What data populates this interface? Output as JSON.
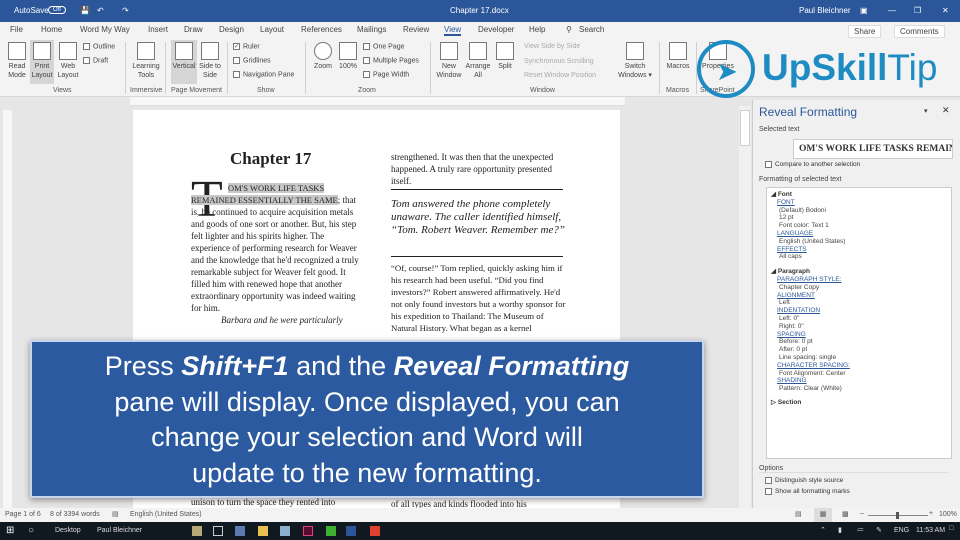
{
  "titlebar": {
    "autosave": "AutoSave",
    "autosave_state": "Off",
    "doc_title": "Chapter 17.docx",
    "user": "Paul Bleichner"
  },
  "tabs": [
    "File",
    "Home",
    "Word My Way",
    "Insert",
    "Draw",
    "Design",
    "Layout",
    "References",
    "Mailings",
    "Review",
    "View",
    "Developer",
    "Help"
  ],
  "search": "Search",
  "share": "Share",
  "comments": "Comments",
  "ribbon": {
    "views": {
      "read_mode": "Read Mode",
      "print_layout": "Print Layout",
      "web_layout": "Web Layout",
      "outline": "Outline",
      "draft": "Draft",
      "group": "Views"
    },
    "immersive": {
      "learning_tools": "Learning Tools",
      "group": "Immersive"
    },
    "page_movement": {
      "vertical": "Vertical",
      "side_to_side": "Side to Side",
      "group": "Page Movement"
    },
    "show": {
      "ruler": "Ruler",
      "ruler_checked": true,
      "gridlines": "Gridlines",
      "navigation_pane": "Navigation Pane",
      "group": "Show"
    },
    "zoom": {
      "zoom": "Zoom",
      "hundred": "100%",
      "one_page": "One Page",
      "multiple_pages": "Multiple Pages",
      "page_width": "Page Width",
      "group": "Zoom"
    },
    "window": {
      "new_window": "New Window",
      "arrange_all": "Arrange All",
      "split": "Split",
      "view_side_by_side": "View Side by Side",
      "sync_scrolling": "Synchronous Scrolling",
      "reset_position": "Reset Window Position",
      "switch_windows": "Switch Windows",
      "group": "Window"
    },
    "macros": {
      "macros": "Macros",
      "group": "Macros"
    },
    "sharepoint": {
      "properties": "Properties",
      "group": "SharePoint"
    }
  },
  "logo": {
    "text_bold": "UpSkill",
    "text_light": "Tip",
    "color": "#1e8bc3"
  },
  "document": {
    "chapter_title": "Chapter 17",
    "drop_cap": "T",
    "selected_text": "OM'S WORK LIFE TASKS REMAINED ESSENTIALLY THE SAME",
    "left_col": "; that is, he continued to acquire acquisition metals and goods of one sort or another. But, his step felt lighter and his spirits higher. The experience of performing research for Weaver and the knowledge that he'd recognized a truly remarkable subject for Weaver felt good. It filled him with renewed hope that another extraordinary opportunity was indeed waiting for him.",
    "left_italic": "Barbara and he were particularly",
    "left_bottom": "unison to turn the space they rented into",
    "right_top": "strengthened. It was then that the unexpected happened. A truly rare opportunity presented itself.",
    "pull_quote": "Tom answered the phone completely unaware. The caller identified himself, “Tom. Robert Weaver. Remember me?”",
    "right_body": "“Of, course!” Tom replied, quickly asking him if his research had been useful. “Did you find investors?” Robert answered affirmatively. He'd not only found investors but a worthy sponsor for his expedition to Thailand: The Museum of Natural History. What began as a kernel",
    "right_bottom": "of all types and kinds flooded into his"
  },
  "overlay": {
    "l1a": "Press ",
    "l1b": "Shift+F1",
    "l1c": " and the ",
    "l1d": "Reveal Formatting",
    "l2": "pane will display. Once displayed, you can",
    "l3": "change your selection and Word will",
    "l4": "update to the new formatting."
  },
  "pane": {
    "title": "Reveal Formatting",
    "selected_label": "Selected text",
    "selected_value": "OM'S WORK LIFE TASKS REMAINED E",
    "compare": "Compare to another selection",
    "formatting_label": "Formatting of selected text",
    "font_head": "Font",
    "font_link": "FONT",
    "font_vals": [
      "(Default) Bodoni",
      "12 pt",
      "Font color: Text 1"
    ],
    "language_link": "LANGUAGE",
    "language_val": "English (United States)",
    "effects_link": "EFFECTS",
    "effects_val": "All caps",
    "para_head": "Paragraph",
    "pstyle_link": "PARAGRAPH STYLE:",
    "pstyle_val": "Chapter Copy",
    "align_link": "ALIGNMENT",
    "align_val": "Left",
    "indent_link": "INDENTATION",
    "indent_vals": [
      "Left:  0\"",
      "Right:  0\""
    ],
    "spacing_link": "SPACING",
    "spacing_vals": [
      "Before:  0 pt",
      "After:  0 pt",
      "Line spacing:  single"
    ],
    "charsp_link": "CHARACTER SPACING:",
    "charsp_val": "Font Alignment: Center",
    "shading_link": "SHADING",
    "shading_val": "Pattern: Clear (White)",
    "section_head": "Section",
    "options": "Options",
    "distinguish": "Distinguish style source",
    "show_marks": "Show all formatting marks"
  },
  "status": {
    "page": "Page 1 of 6",
    "words": "8 of 3394 words",
    "language": "English (United States)",
    "zoom": "100%"
  },
  "taskbar": {
    "desktop": "Desktop",
    "user": "Paul Bleichner",
    "lang": "ENG",
    "time": "11:53 AM"
  }
}
